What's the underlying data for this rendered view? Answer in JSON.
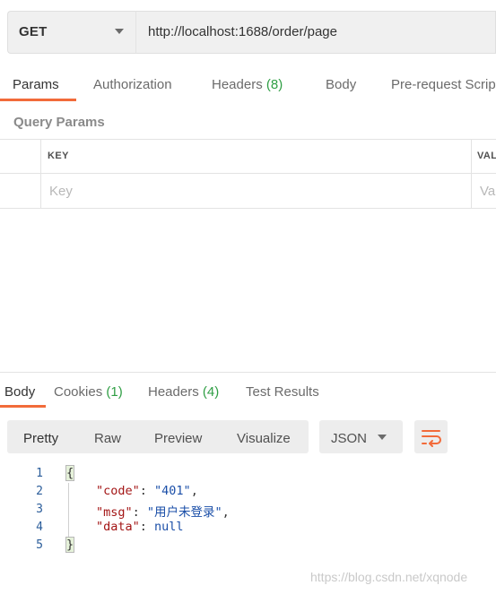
{
  "request": {
    "method": "GET",
    "url": "http://localhost:1688/order/page"
  },
  "request_tabs": [
    {
      "label": "Params",
      "count": ""
    },
    {
      "label": "Authorization",
      "count": ""
    },
    {
      "label": "Headers",
      "count": "(8)"
    },
    {
      "label": "Body",
      "count": ""
    },
    {
      "label": "Pre-request Scrip",
      "count": ""
    }
  ],
  "query_params": {
    "title": "Query Params",
    "columns": {
      "key": "KEY",
      "value": "VAL"
    },
    "placeholder": {
      "key": "Key",
      "value": "Va"
    }
  },
  "response_tabs": [
    {
      "label": "Body",
      "count": ""
    },
    {
      "label": "Cookies",
      "count": "(1)"
    },
    {
      "label": "Headers",
      "count": "(4)"
    },
    {
      "label": "Test Results",
      "count": ""
    }
  ],
  "view_modes": [
    "Pretty",
    "Raw",
    "Preview",
    "Visualize"
  ],
  "format": "JSON",
  "code_lines": [
    {
      "num": "1",
      "text": "{"
    },
    {
      "num": "2",
      "key": "\"code\"",
      "value": "\"401\"",
      "tail": ","
    },
    {
      "num": "3",
      "key": "\"msg\"",
      "value": "\"用户未登录\"",
      "tail": ","
    },
    {
      "num": "4",
      "key": "\"data\"",
      "value": "null",
      "tail": ""
    },
    {
      "num": "5",
      "text": "}"
    }
  ],
  "watermark": "https://blog.csdn.net/xqnode",
  "colors": {
    "accent": "#f26b3a",
    "count": "#2f9e44",
    "string": "#1b4fa8",
    "key": "#a31515"
  }
}
